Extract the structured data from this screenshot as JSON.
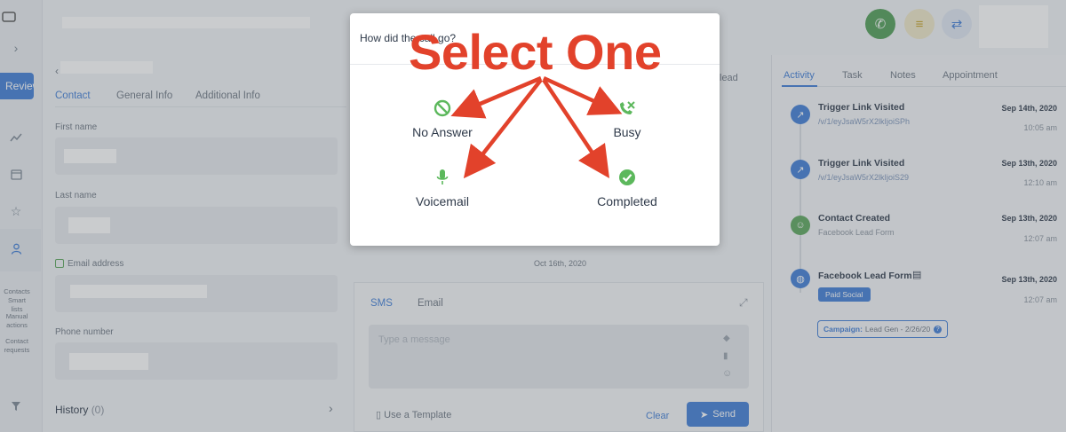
{
  "left_rail": {
    "review_label": "Reviewed",
    "nav_items": [
      "Contacts",
      "Smart lists",
      "Manual actions",
      "Contact requests"
    ]
  },
  "contact": {
    "tabs": [
      "Contact",
      "General Info",
      "Additional Info"
    ],
    "fields": [
      {
        "label": "First name"
      },
      {
        "label": "Last name"
      },
      {
        "label": "Email address"
      },
      {
        "label": "Phone number"
      }
    ],
    "history_label": "History",
    "history_count": "(0)"
  },
  "center": {
    "partial_text_top": "lead",
    "date_label": "Oct 16th, 2020",
    "tabs": [
      "SMS",
      "Email"
    ],
    "placeholder": "Type a message",
    "use_template": "Use a Template",
    "clear_label": "Clear",
    "send_label": "Send"
  },
  "activity": {
    "tabs": [
      "Activity",
      "Task",
      "Notes",
      "Appointment"
    ],
    "items": [
      {
        "title": "Trigger Link Visited",
        "sub": "/v/1/eyJsaW5rX2lkIjoiSPh",
        "date": "Sep 14th, 2020",
        "time": "10:05 am",
        "icon": "external-link-icon",
        "color": "#3f7dd6"
      },
      {
        "title": "Trigger Link Visited",
        "sub": "/v/1/eyJsaW5rX2lkIjoiS29",
        "date": "Sep 13th, 2020",
        "time": "12:10 am",
        "icon": "external-link-icon",
        "color": "#3f7dd6"
      },
      {
        "title": "Contact Created",
        "sub": "Facebook Lead Form",
        "date": "Sep 13th, 2020",
        "time": "12:07 am",
        "icon": "user-plus-icon",
        "color": "#5aa55a"
      },
      {
        "title": "Facebook Lead Form",
        "sub": "",
        "date": "Sep 13th, 2020",
        "time": "12:07 am",
        "icon": "globe-icon",
        "color": "#3f7dd6"
      }
    ],
    "paid_social_label": "Paid Social",
    "campaign_label": "Campaign:",
    "campaign_value": "Lead Gen - 2/26/20"
  },
  "modal": {
    "question": "How did the call go?",
    "options": [
      {
        "label": "No Answer",
        "icon": "no-entry-icon",
        "color": "#5cb85c"
      },
      {
        "label": "Busy",
        "icon": "phone-missed-icon",
        "color": "#5cb85c"
      },
      {
        "label": "Voicemail",
        "icon": "microphone-icon",
        "color": "#5cb85c"
      },
      {
        "label": "Completed",
        "icon": "check-circle-icon",
        "color": "#5cb85c"
      }
    ]
  },
  "annotation": {
    "text": "Select One",
    "color": "#e2422b"
  }
}
